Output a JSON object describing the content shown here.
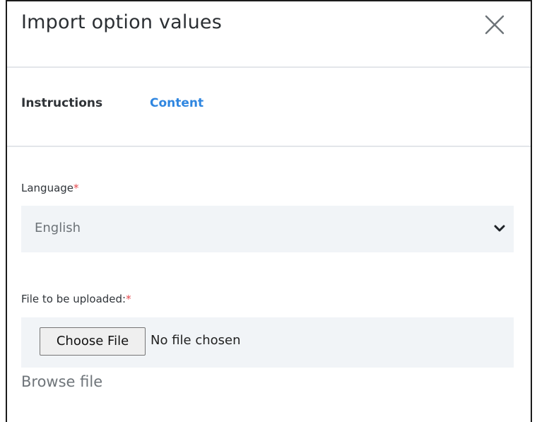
{
  "dialog": {
    "title": "Import option values",
    "close_icon": "close-icon"
  },
  "tabs": [
    {
      "label": "Instructions",
      "active": false
    },
    {
      "label": "Content",
      "active": true
    }
  ],
  "language": {
    "label": "Language",
    "required_mark": "*",
    "selected": "English",
    "dropdown_icon": "chevron-down-icon"
  },
  "file_upload": {
    "label": "File to be uploaded:",
    "required_mark": "*",
    "button_label": "Choose File",
    "status": "No file chosen",
    "hint": "Browse file"
  },
  "colors": {
    "accent": "#2f86e0",
    "required": "#e5484d",
    "field_bg": "#f1f4f7"
  }
}
